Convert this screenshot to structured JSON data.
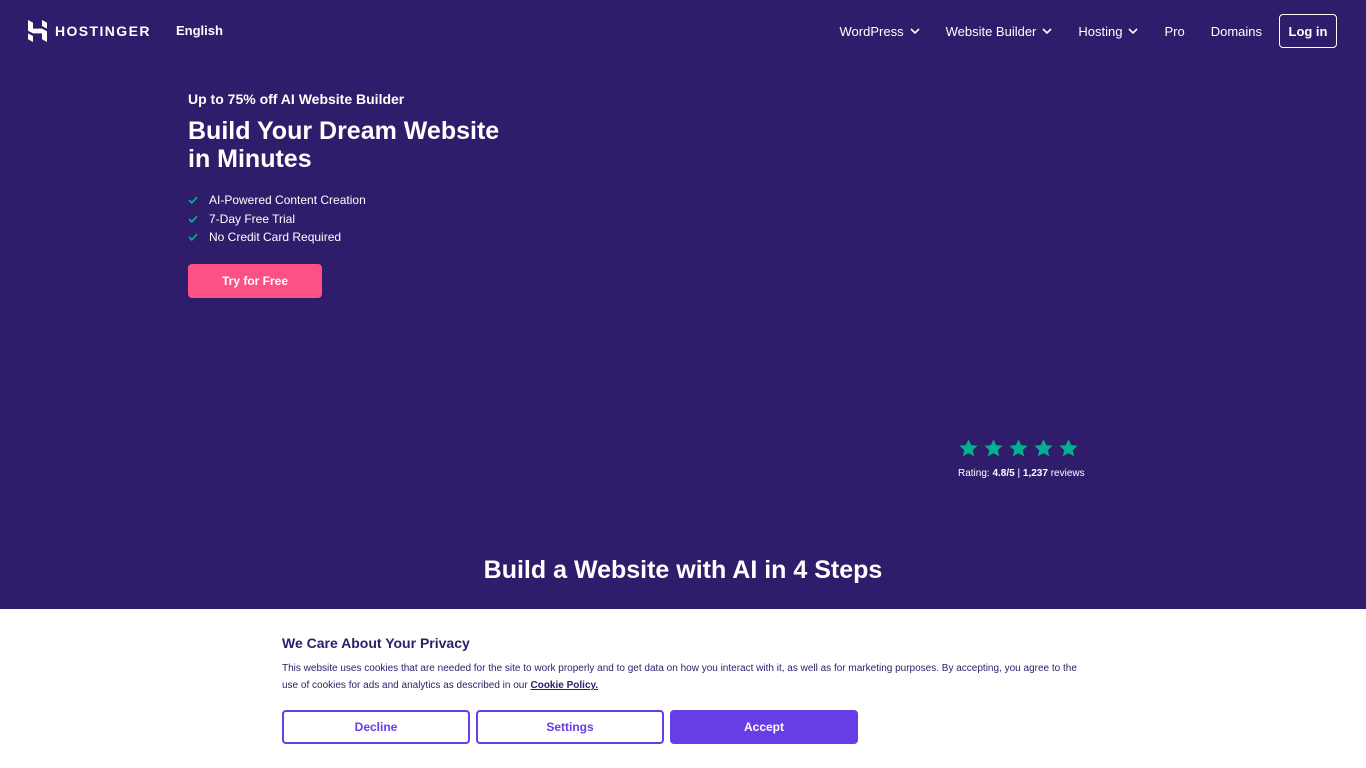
{
  "header": {
    "logo_text": "HOSTINGER",
    "language": "English",
    "nav": [
      {
        "label": "WordPress",
        "has_dropdown": true
      },
      {
        "label": "Website Builder",
        "has_dropdown": true
      },
      {
        "label": "Hosting",
        "has_dropdown": true
      },
      {
        "label": "Pro",
        "has_dropdown": false
      },
      {
        "label": "Domains",
        "has_dropdown": false
      }
    ],
    "login_label": "Log in"
  },
  "hero": {
    "promo": "Up to 75% off AI Website Builder",
    "headline": "Build Your Dream Website in Minutes",
    "features": [
      "AI-Powered Content Creation",
      "7-Day Free Trial",
      "No Credit Card Required"
    ],
    "cta_label": "Try for Free"
  },
  "rating": {
    "stars": 5,
    "label": "Rating:",
    "score": "4.8/5",
    "separator": "|",
    "reviews_count": "1,237",
    "reviews_label": "reviews"
  },
  "section": {
    "title": "Build a Website with AI in 4 Steps"
  },
  "cookie_banner": {
    "title": "We Care About Your Privacy",
    "body": "This website uses cookies that are needed for the site to work properly and to get data on how you interact with it, as well as for marketing purposes. By accepting, you agree to the use of cookies for ads and analytics as described in our",
    "link_label": "Cookie Policy.",
    "decline_label": "Decline",
    "settings_label": "Settings",
    "accept_label": "Accept"
  },
  "colors": {
    "background": "#2f1c6a",
    "accent_pink": "#fc5185",
    "accent_purple": "#673de6",
    "check_green": "#00b090",
    "star_green": "#00b090"
  }
}
